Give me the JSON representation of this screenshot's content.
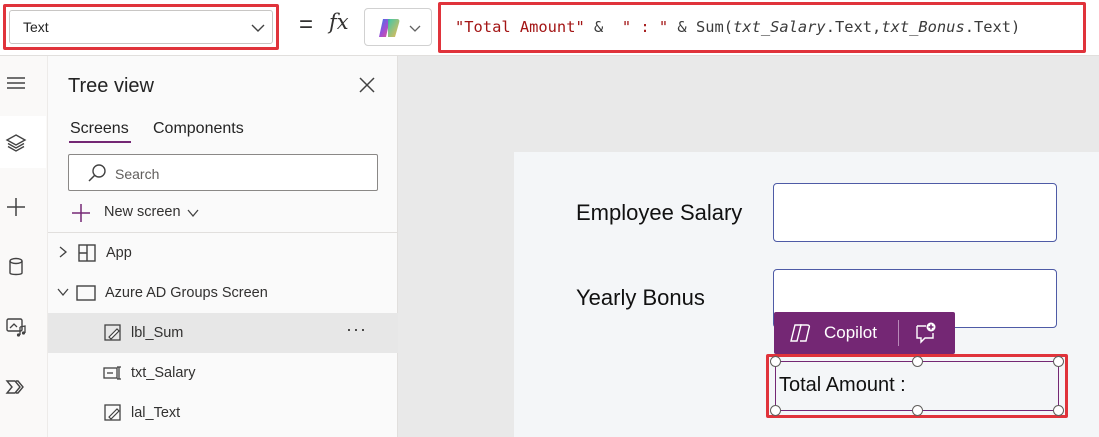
{
  "formula_bar": {
    "property": "Text",
    "equals": "=",
    "fx": "fx",
    "formula": {
      "s1": "\"Total Amount\"",
      "op1": " &  ",
      "s2": "\" : \"",
      "op2": " & Sum(",
      "v1": "txt_Salary",
      "p1": ".Text,",
      "v2": "txt_Bonus",
      "p2": ".Text)"
    }
  },
  "rail": {
    "items": [
      "menu-icon",
      "layers-icon",
      "plus-icon",
      "database-icon",
      "media-icon",
      "flow-icon"
    ]
  },
  "tree": {
    "title": "Tree view",
    "tabs": {
      "screens": "Screens",
      "components": "Components"
    },
    "search_placeholder": "Search",
    "new_screen": "New screen",
    "nodes": [
      {
        "label": "App"
      },
      {
        "label": "Azure AD Groups Screen"
      },
      {
        "label": "lbl_Sum",
        "more": "···"
      },
      {
        "label": "txt_Salary"
      },
      {
        "label": "lal_Text"
      }
    ]
  },
  "canvas": {
    "fields": [
      {
        "label": "Employee Salary",
        "value": ""
      },
      {
        "label": "Yearly Bonus",
        "value": ""
      }
    ],
    "copilot_label": "Copilot",
    "sum_label": "Total Amount :"
  },
  "colors": {
    "accent": "#742774",
    "highlight": "#e0333b",
    "string": "#a31515"
  }
}
